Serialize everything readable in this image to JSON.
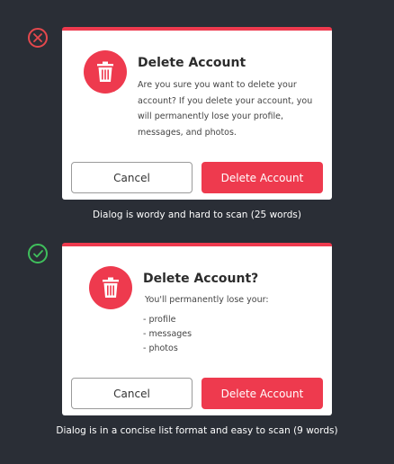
{
  "examples": [
    {
      "verdict_icon": "x-icon",
      "verdict_color": "#e5484d",
      "title": "Delete Account",
      "body": "Are you sure you want to delete your account? If you delete your account, you will permanently lose your profile, messages, and photos.",
      "cancel_label": "Cancel",
      "confirm_label": "Delete Account",
      "caption": "Dialog is wordy and hard to scan (25 words)"
    },
    {
      "verdict_icon": "check-icon",
      "verdict_color": "#3fbf5c",
      "title": "Delete Account?",
      "lead": "You'll permanently lose your:",
      "items": [
        "- profile",
        "- messages",
        "- photos"
      ],
      "cancel_label": "Cancel",
      "confirm_label": "Delete Account",
      "caption": "Dialog is in a concise list format and easy to scan (9 words)"
    }
  ],
  "colors": {
    "background": "#2a2e36",
    "accent": "#ee3a4e",
    "dialog": "#ffffff"
  }
}
